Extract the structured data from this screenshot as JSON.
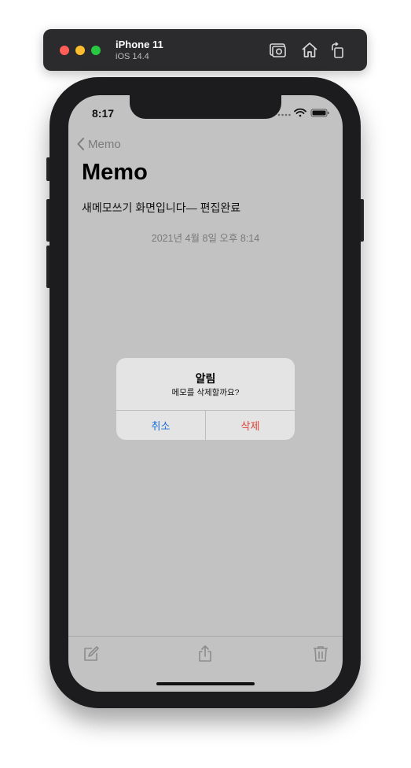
{
  "simulator": {
    "device_name": "iPhone 11",
    "os_version": "iOS 14.4"
  },
  "status_bar": {
    "time": "8:17"
  },
  "nav": {
    "back_label": "Memo",
    "title": "Memo"
  },
  "memo": {
    "content": "새메모쓰기 화면입니다— 편집완료",
    "date": "2021년 4월 8일 오후 8:14"
  },
  "alert": {
    "title": "알림",
    "message": "메모를 삭제할까요?",
    "cancel_label": "취소",
    "delete_label": "삭제"
  },
  "colors": {
    "screen_dim_bg": "#c2c2c2",
    "cancel": "#1a6fd9",
    "destructive": "#e0423b"
  },
  "icons": {
    "toolbar": [
      "compose-icon",
      "share-icon",
      "trash-icon"
    ],
    "simulator": [
      "screenshot-icon",
      "home-icon",
      "rotate-icon"
    ]
  }
}
